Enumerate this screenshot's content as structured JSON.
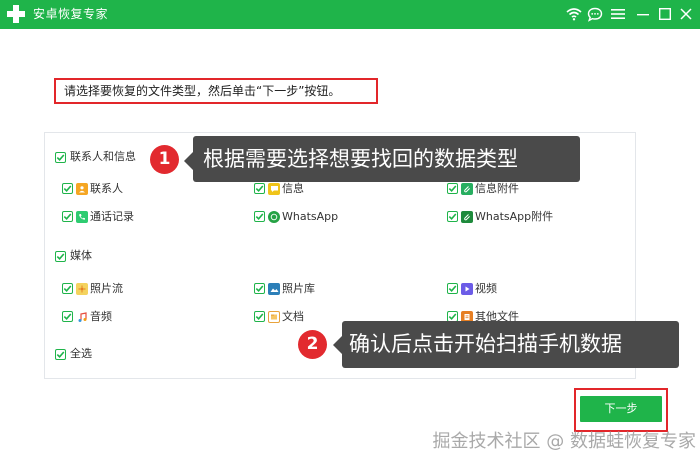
{
  "window": {
    "title": "安卓恢复专家",
    "icons": [
      "plus-logo-icon",
      "wifi-icon",
      "chat-icon",
      "menu-icon",
      "minimize-icon",
      "maximize-icon",
      "close-icon"
    ]
  },
  "instruction": "请选择要恢复的文件类型，然后单击“下一步”按钮。",
  "groups": {
    "contacts": {
      "label": "联系人和信息",
      "items": [
        {
          "label": "联系人",
          "icon": "contact-card-icon"
        },
        {
          "label": "信息",
          "icon": "message-icon"
        },
        {
          "label": "信息附件",
          "icon": "attachment-icon"
        },
        {
          "label": "通话记录",
          "icon": "phone-icon"
        },
        {
          "label": "WhatsApp",
          "icon": "whatsapp-icon"
        },
        {
          "label": "WhatsApp附件",
          "icon": "whatsapp-attachment-icon"
        }
      ]
    },
    "media": {
      "label": "媒体",
      "items": [
        {
          "label": "照片流",
          "icon": "photo-stream-icon"
        },
        {
          "label": "照片库",
          "icon": "photo-library-icon"
        },
        {
          "label": "视频",
          "icon": "video-icon"
        },
        {
          "label": "音频",
          "icon": "audio-icon"
        },
        {
          "label": "文档",
          "icon": "document-icon"
        },
        {
          "label": "其他文件",
          "icon": "other-files-icon"
        }
      ]
    },
    "select_all": {
      "label": "全选"
    }
  },
  "callouts": [
    {
      "number": "1",
      "text": "根据需要选择想要找回的数据类型"
    },
    {
      "number": "2",
      "text": "确认后点击开始扫描手机数据"
    }
  ],
  "buttons": {
    "next": "下一步"
  },
  "watermark": "掘金技术社区 @ 数据蛙恢复专家",
  "colors": {
    "accent": "#1fb44a",
    "highlight": "#e2262a",
    "callout": "#4a4a4a"
  }
}
